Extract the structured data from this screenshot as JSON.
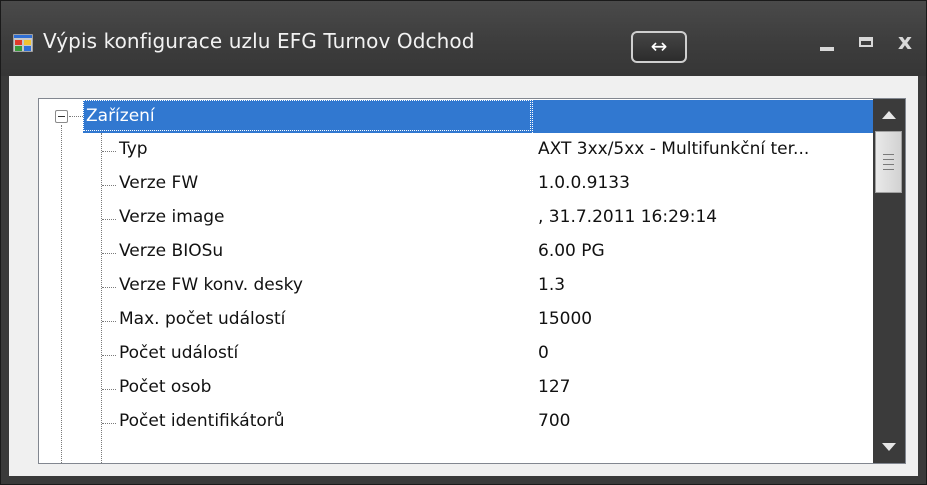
{
  "window": {
    "title": "Výpis konfigurace uzlu EFG Turnov Odchod",
    "resize_symbol": "↔",
    "close_symbol": "x",
    "icon": "app-window-icon"
  },
  "tree": {
    "root_label": "Zařízení",
    "items": [
      {
        "label": "Typ",
        "value": "AXT 3xx/5xx - Multifunkční ter..."
      },
      {
        "label": "Verze FW",
        "value": "1.0.0.9133"
      },
      {
        "label": "Verze image",
        "value": ", 31.7.2011 16:29:14"
      },
      {
        "label": "Verze BIOSu",
        "value": "6.00 PG"
      },
      {
        "label": "Verze FW konv. desky",
        "value": "1.3"
      },
      {
        "label": "Max. počet událostí",
        "value": "15000"
      },
      {
        "label": "Počet událostí",
        "value": "0"
      },
      {
        "label": "Počet osob",
        "value": "127"
      },
      {
        "label": "Počet identifikátorů",
        "value": "700"
      }
    ]
  },
  "colors": {
    "title_bg": "#3d3d3d",
    "selection": "#3178d0",
    "scrollbar": "#3b3b3b"
  }
}
